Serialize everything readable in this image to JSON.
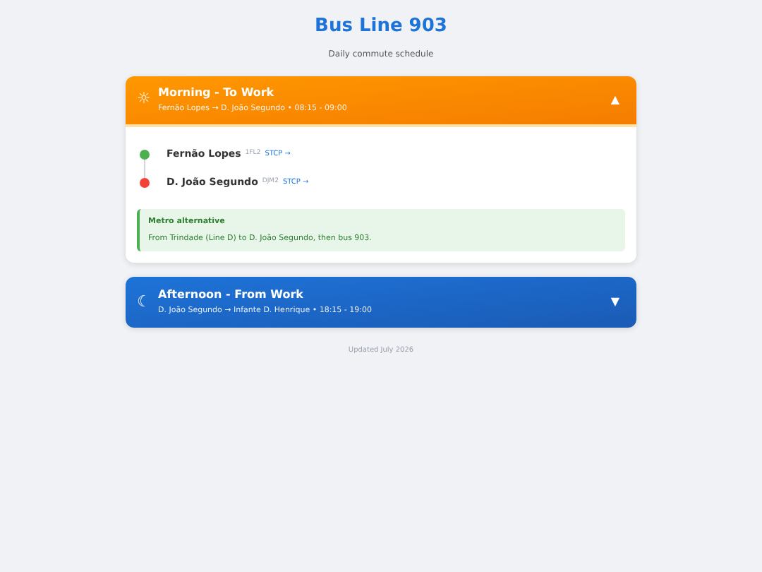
{
  "title": "Bus Line 903",
  "subtitle": "Daily commute schedule",
  "sections": [
    {
      "kind": "morning",
      "icon": "☼",
      "title": "Morning - To Work",
      "summary": "Fernão Lopes → D. João Segundo • 08:15 - 09:00",
      "toggle": "▲",
      "expanded": true,
      "stops": [
        {
          "name": "Fernão Lopes",
          "code": "1FL2",
          "link": "STCP →",
          "color": "#4caf50"
        },
        {
          "name": "D. João Segundo",
          "code": "DJM2",
          "link": "STCP →",
          "color": "#f44336"
        }
      ],
      "note": {
        "title": "Metro alternative",
        "text": "From Trindade (Line D) to D. João Segundo, then bus 903."
      }
    },
    {
      "kind": "afternoon",
      "icon": "☾",
      "title": "Afternoon - From Work",
      "summary": "D. João Segundo → Infante D. Henrique • 18:15 - 19:00",
      "toggle": "▼",
      "expanded": false
    }
  ],
  "footer": "Updated July 2026"
}
